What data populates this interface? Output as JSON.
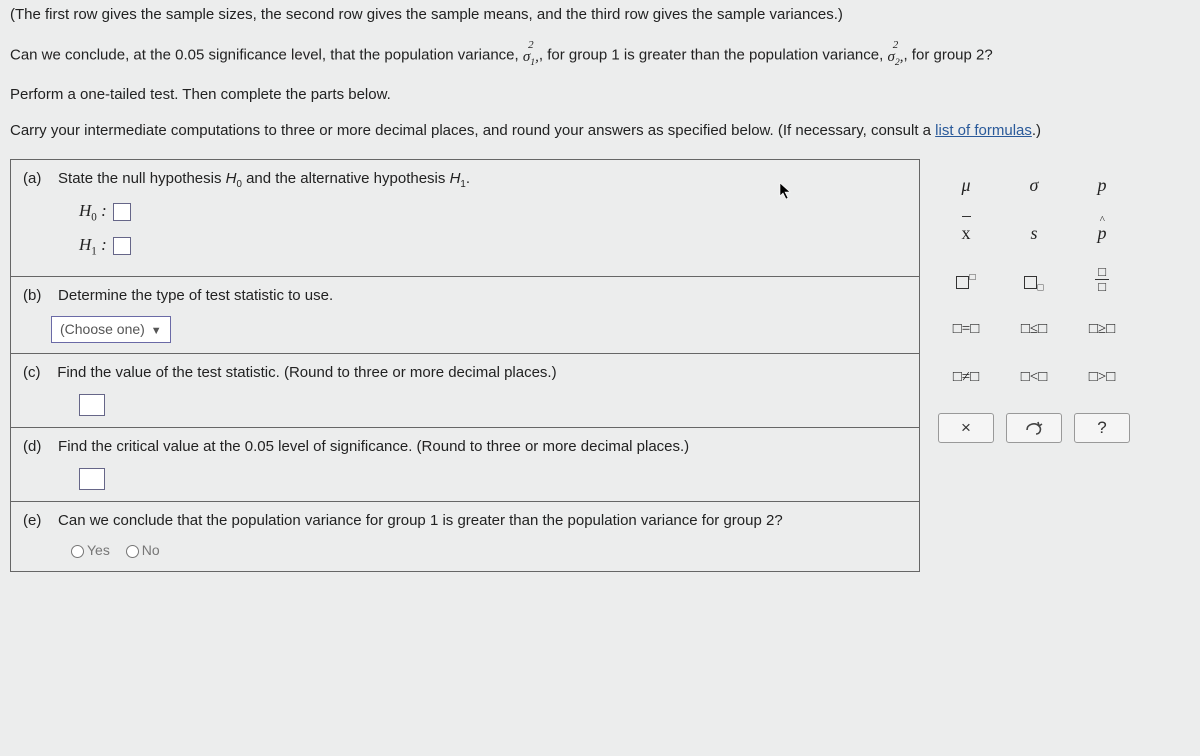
{
  "intro": {
    "p1": "(The first row gives the sample sizes, the second row gives the sample means, and the third row gives the sample variances.)",
    "p2_a": "Can we conclude, at the ",
    "p2_sig": "0.05",
    "p2_b": " significance level, that the population variance, ",
    "p2_c": ", for group 1 is greater than the population variance, ",
    "p2_d": ", for group 2?",
    "p3": "Perform a one-tailed test. Then complete the parts below.",
    "p4_a": "Carry your intermediate computations to three or more decimal places, and round your answers as specified below. (If necessary, consult a ",
    "p4_link": "list of formulas",
    "p4_b": ".)"
  },
  "parts": {
    "a": {
      "label": "(a)",
      "text": "State the null hypothesis H₀ and the alternative hypothesis H₁.",
      "h0": "H₀ : ",
      "h1": "H₁ : "
    },
    "b": {
      "label": "(b)",
      "text": "Determine the type of test statistic to use.",
      "dropdown": "(Choose one)"
    },
    "c": {
      "label": "(c)",
      "text": "Find the value of the test statistic. (Round to three or more decimal places.)"
    },
    "d": {
      "label": "(d)",
      "text": "Find the critical value at the 0.05 level of significance. (Round to three or more decimal places.)"
    },
    "e": {
      "label": "(e)",
      "text": "Can we conclude that the population variance for group 1 is greater than the population variance for group 2?",
      "yes": "Yes",
      "no": "No"
    }
  },
  "palette": {
    "r1": [
      "μ",
      "σ",
      "p"
    ],
    "r2": [
      "x̄",
      "s",
      "p̂"
    ],
    "r4": [
      "□=□",
      "□≤□",
      "□≥□"
    ],
    "r5": [
      "□≠□",
      "□<□",
      "□>□"
    ],
    "tools": {
      "close": "×",
      "help": "?"
    }
  }
}
